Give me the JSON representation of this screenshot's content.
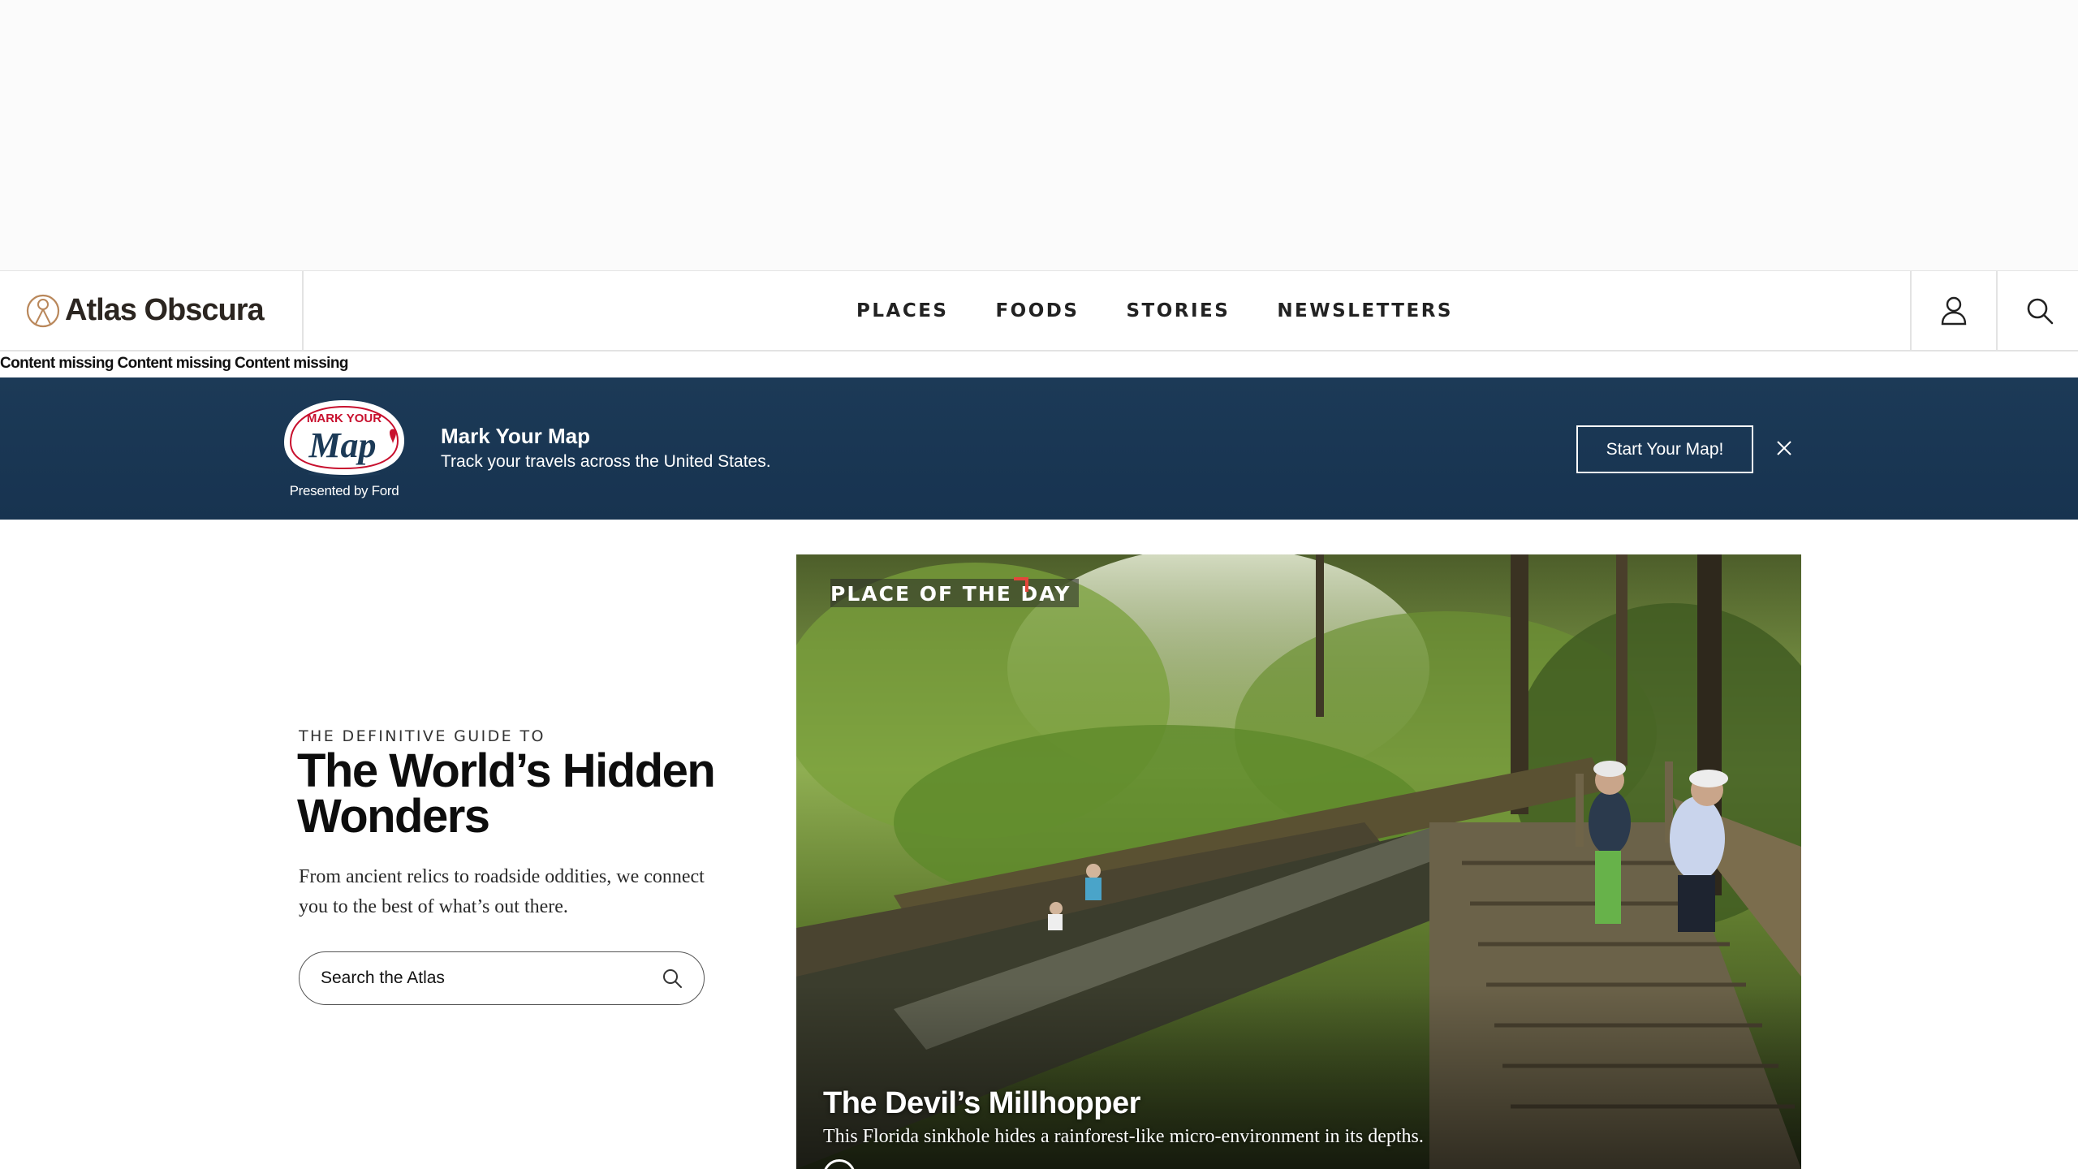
{
  "site": {
    "logo_text": "Atlas Obscura"
  },
  "nav": {
    "items": [
      {
        "label": "PLACES"
      },
      {
        "label": "FOODS"
      },
      {
        "label": "STORIES"
      },
      {
        "label": "NEWSLETTERS"
      }
    ],
    "user_icon": "user-icon",
    "search_icon": "search-icon"
  },
  "missing_notice": "Content missing Content missing Content missing",
  "promo": {
    "badge_text_top": "MARK YOUR",
    "badge_text_main": "Map",
    "presented_by": "Presented by Ford",
    "title": "Mark Your Map",
    "subtitle": "Track your travels across the United States.",
    "cta": "Start Your Map!",
    "close_icon": "close-icon",
    "background": "#1c3a57"
  },
  "hero": {
    "eyebrow": "THE DEFINITIVE GUIDE TO",
    "title": "The World’s Hidden Wonders",
    "description": "From ancient relics to roadside oddities, we connect you to the best of what’s out there.",
    "search_placeholder": "Search the Atlas"
  },
  "place_of_the_day": {
    "label": "PLACE OF THE DAY",
    "title": "The Devil’s Millhopper",
    "description": "This Florida sinkhole hides a rainforest-like micro-environment in its depths.",
    "accent": "#e2473b"
  }
}
